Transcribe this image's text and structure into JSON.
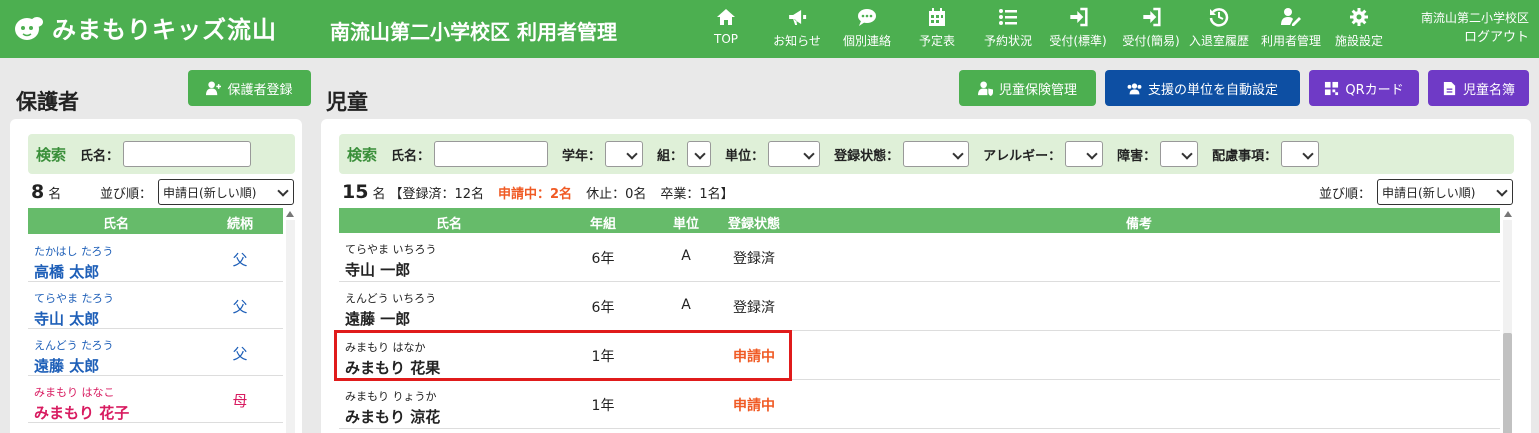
{
  "header": {
    "logo_text": "みまもりキッズ流山",
    "page_title": "南流山第二小学校区 利用者管理",
    "school": "南流山第二小学校区",
    "logout": "ログアウト",
    "nav": [
      {
        "label": "TOP",
        "icon": "home-icon"
      },
      {
        "label": "お知らせ",
        "icon": "megaphone-icon"
      },
      {
        "label": "個別連絡",
        "icon": "chat-icon"
      },
      {
        "label": "予定表",
        "icon": "calendar-icon"
      },
      {
        "label": "予約状況",
        "icon": "list-icon"
      },
      {
        "label": "受付(標準)",
        "icon": "sign-in-icon"
      },
      {
        "label": "受付(簡易)",
        "icon": "sign-in-icon"
      },
      {
        "label": "入退室履歴",
        "icon": "history-icon"
      },
      {
        "label": "利用者管理",
        "icon": "user-edit-icon"
      },
      {
        "label": "施設設定",
        "icon": "gear-icon"
      }
    ]
  },
  "guardians": {
    "title": "保護者",
    "register_button": "保護者登録",
    "search_label": "検索",
    "name_label": "氏名：",
    "count": "8",
    "count_unit": "名",
    "sort_label": "並び順：",
    "sort_value": "申請日(新しい順)",
    "columns": [
      "氏名",
      "続柄"
    ],
    "rows": [
      {
        "kana": "たかはし たろう",
        "name": "高橋 太郎",
        "relation": "父",
        "color": "#1e5fb8"
      },
      {
        "kana": "てらやま たろう",
        "name": "寺山 太郎",
        "relation": "父",
        "color": "#1e5fb8"
      },
      {
        "kana": "えんどう たろう",
        "name": "遠藤 太郎",
        "relation": "父",
        "color": "#1e5fb8"
      },
      {
        "kana": "みまもり はなこ",
        "name": "みまもり 花子",
        "relation": "母",
        "color": "#d81b60"
      }
    ]
  },
  "children": {
    "title": "児童",
    "buttons": {
      "insurance": "児童保険管理",
      "auto_unit": "支援の単位を自動設定",
      "qr": "QRカード",
      "roster": "児童名簿"
    },
    "search": {
      "label": "検索",
      "name": "氏名：",
      "grade": "学年：",
      "class": "組：",
      "unit": "単位：",
      "status": "登録状態：",
      "allergy": "アレルギー：",
      "disability": "障害：",
      "notes": "配慮事項："
    },
    "summary": {
      "count": "15",
      "unit": "名",
      "registered": "【登録済：12名",
      "applying": "申請中：2名",
      "suspended": "休止：0名",
      "graduated": "卒業：1名】"
    },
    "sort_label": "並び順：",
    "sort_value": "申請日(新しい順)",
    "columns": [
      "氏名",
      "年組",
      "単位",
      "登録状態",
      "備考"
    ],
    "rows": [
      {
        "kana": "てらやま いちろう",
        "name": "寺山 一郎",
        "grade": "6年",
        "unit": "A",
        "status": "登録済",
        "applying": false
      },
      {
        "kana": "えんどう いちろう",
        "name": "遠藤 一郎",
        "grade": "6年",
        "unit": "A",
        "status": "登録済",
        "applying": false
      },
      {
        "kana": "みまもり はなか",
        "name": "みまもり 花果",
        "grade": "1年",
        "unit": "",
        "status": "申請中",
        "applying": true
      },
      {
        "kana": "みまもり りょうか",
        "name": "みまもり 涼花",
        "grade": "1年",
        "unit": "",
        "status": "申請中",
        "applying": true
      }
    ]
  },
  "colors": {
    "header": "#4caf50",
    "table_header": "#66bb6a",
    "applying": "#f05a24",
    "highlight": "#e01b1b"
  }
}
